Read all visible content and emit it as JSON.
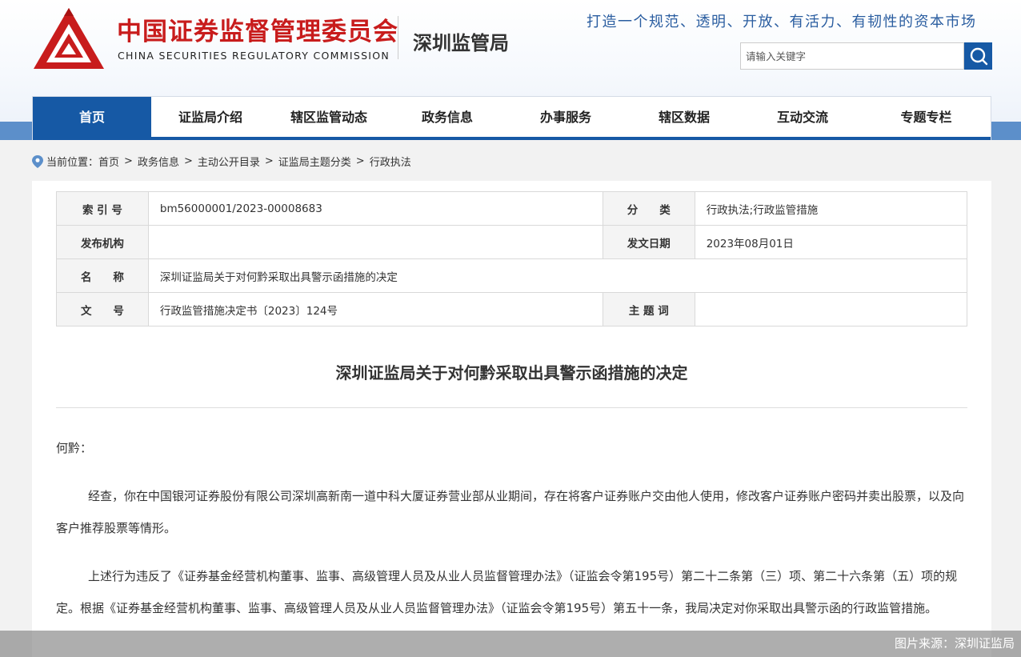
{
  "header": {
    "cn_title": "中国证券监督管理委员会",
    "en_title": "CHINA SECURITIES REGULATORY COMMISSION",
    "bureau": "深圳监管局",
    "slogan": "打造一个规范、透明、开放、有活力、有韧性的资本市场",
    "logo_icon": "csrc-logo-icon",
    "brand_color": "#c81c1c",
    "accent_color": "#1659a5"
  },
  "search": {
    "placeholder": "请输入关键字",
    "button_icon": "search-icon"
  },
  "nav": {
    "items": [
      "首页",
      "证监局介绍",
      "辖区监管动态",
      "政务信息",
      "办事服务",
      "辖区数据",
      "互动交流",
      "专题专栏"
    ],
    "active": "首页"
  },
  "breadcrumb": {
    "icon": "location-pin-icon",
    "label": "当前位置：",
    "items": [
      "首页",
      "政务信息",
      "主动公开目录",
      "证监局主题分类",
      "行政执法"
    ],
    "separator": ">"
  },
  "meta": {
    "index_label": "索 引 号",
    "index_value": "bm56000001/2023-00008683",
    "category_label": "分　　类",
    "category_value": "行政执法;行政监管措施",
    "publisher_label": "发布机构",
    "publisher_value": "",
    "date_label": "发文日期",
    "date_value": "2023年08月01日",
    "name_label": "名　　称",
    "name_value": "深圳证监局关于对何黔采取出具警示函措施的决定",
    "docno_label": "文　　号",
    "docno_value": "行政监管措施决定书〔2023〕124号",
    "keywords_label": "主 题 词",
    "keywords_value": ""
  },
  "document": {
    "title": "深圳证监局关于对何黔采取出具警示函措施的决定",
    "salutation": "何黔：",
    "paragraph1": "经查，你在中国银河证券股份有限公司深圳高新南一道中科大厦证券营业部从业期间，存在将客户证券账户交由他人使用，修改客户证券账户密码并卖出股票，以及向客户推荐股票等情形。",
    "paragraph2": "上述行为违反了《证券基金经营机构董事、监事、高级管理人员及从业人员监督管理办法》（证监会令第195号）第二十二条第（三）项、第二十六条第（五）项的规定。根据《证券基金经营机构董事、监事、高级管理人员及从业人员监督管理办法》（证监会令第195号）第五十一条，我局决定对你采取出具警示函的行政监管措施。"
  },
  "credit": "图片来源：深圳证监局"
}
